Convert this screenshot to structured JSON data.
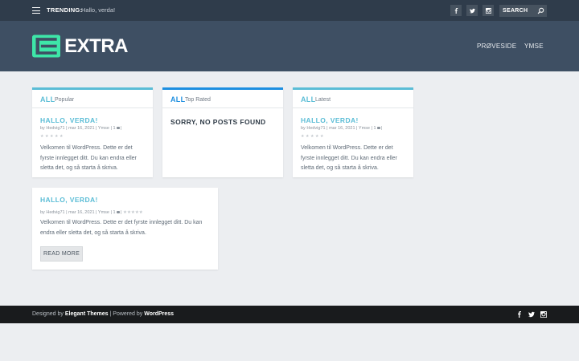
{
  "topbar": {
    "trending_label": "TRENDING:",
    "trending_link": "Hallo, verda!",
    "social": [
      "facebook-icon",
      "twitter-icon",
      "instagram-icon"
    ],
    "search_placeholder": "SEARCH"
  },
  "header": {
    "logo_text": "EXTRA",
    "nav": [
      "PRØVESIDE",
      "YMSE"
    ]
  },
  "colors": {
    "accent": "#5bbdd6",
    "top_rated_border": "#1e8fe0",
    "topbar_bg": "#2f3c4b",
    "header_bg": "#3e4f63",
    "footer_bg": "#191b1d",
    "logo_green": "#3ee6a8"
  },
  "cards": {
    "popular": {
      "all": "ALL",
      "tab": "Popular",
      "title": "HALLO, VERDA!",
      "meta_prefix": "by",
      "author": "Hedvig71",
      "date": "mar 16, 2021",
      "category": "Ymse",
      "comments": "1",
      "excerpt": "Velkomen til WordPress. Dette er det fyrste innlegget ditt. Du kan endra eller sletta det, og så starta å skriva."
    },
    "top_rated": {
      "all": "ALL",
      "tab": "Top Rated",
      "empty": "SORRY, NO POSTS FOUND"
    },
    "latest": {
      "all": "ALL",
      "tab": "Latest",
      "title": "HALLO, VERDA!",
      "meta_prefix": "by",
      "author": "Hedvig71",
      "date": "mar 16, 2021",
      "category": "Ymse",
      "comments": "1",
      "excerpt": "Velkomen til WordPress. Dette er det fyrste innlegget ditt. Du kan endra eller sletta det, og så starta å skriva."
    },
    "single": {
      "title": "HALLO, VERDA!",
      "meta_prefix": "by",
      "author": "Hedvig71",
      "date": "mar 16, 2021",
      "category": "Ymse",
      "comments": "1",
      "excerpt": "Velkomen til WordPress. Dette er det fyrste innlegget ditt. Du kan endra eller sletta det, og så starta å skriva.",
      "read_more": "READ MORE"
    }
  },
  "footer": {
    "designed_by": "Designed by",
    "elegant": "Elegant Themes",
    "sep": "|",
    "powered_by": "Powered by",
    "wordpress": "WordPress",
    "social": [
      "facebook-icon",
      "twitter-icon",
      "instagram-icon"
    ]
  }
}
